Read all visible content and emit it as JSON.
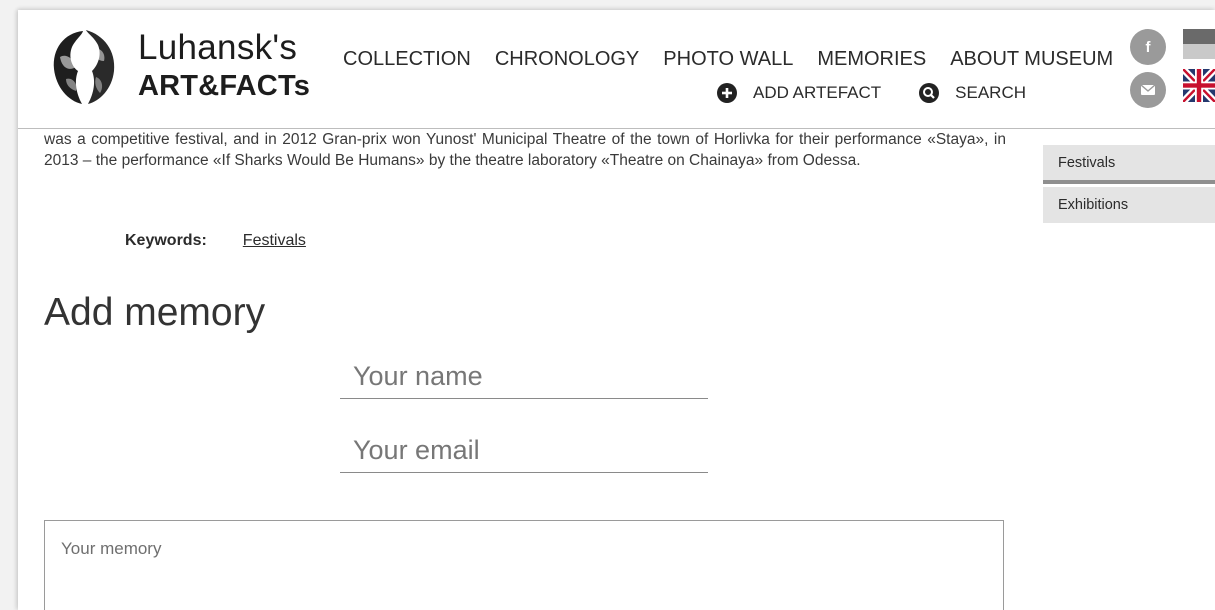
{
  "brand": {
    "line1": "Luhansk's",
    "line2": "ART&FACTs"
  },
  "nav": [
    {
      "label": "COLLECTION"
    },
    {
      "label": "CHRONOLOGY"
    },
    {
      "label": "PHOTO WALL"
    },
    {
      "label": "MEMORIES"
    },
    {
      "label": "ABOUT MUSEUM"
    }
  ],
  "actions": {
    "add": "ADD ARTEFACT",
    "search": "SEARCH"
  },
  "social": {
    "facebook": "f"
  },
  "article": {
    "text": "was a competitive festival, and in 2012 Gran-prix won Yunost' Municipal Theatre of the town of Horlivka for their performance «Staya», in 2013 – the performance «If Sharks Would Be Humans» by the theatre laboratory «Theatre on Chainaya» from Odessa."
  },
  "keywords": {
    "label": "Keywords:",
    "items": [
      "Festivals"
    ]
  },
  "form": {
    "title": "Add memory",
    "name_placeholder": "Your name",
    "email_placeholder": "Your email",
    "memory_placeholder": "Your memory"
  },
  "sidebar": {
    "tags": [
      "Festivals",
      "Exhibitions"
    ]
  },
  "colors": {
    "social": "#9a9a9a",
    "tag_bg": "#e4e4e4",
    "tag_separator": "#8f8f8f"
  }
}
